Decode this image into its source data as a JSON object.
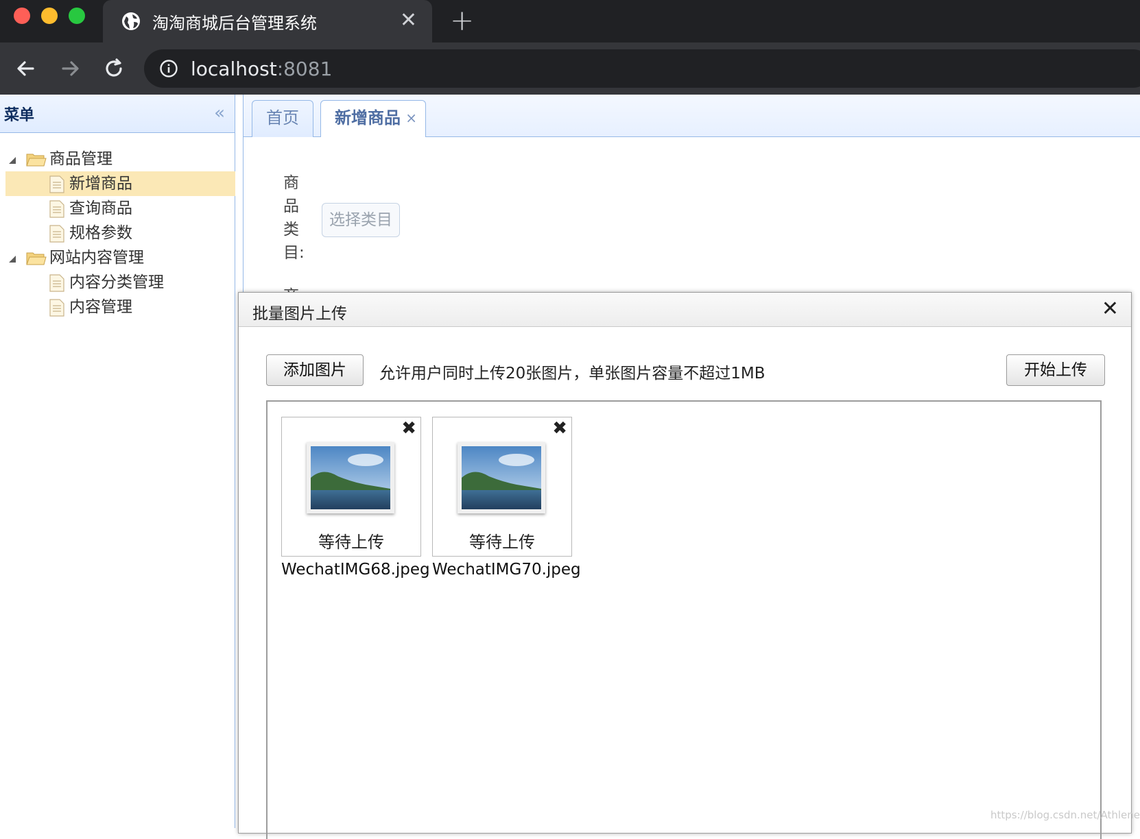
{
  "browser": {
    "tab_title": "淘淘商城后台管理系统",
    "tab_close": "✕",
    "new_tab": "+",
    "url_host": "localhost",
    "url_port": ":8081"
  },
  "menu": {
    "title": "菜单",
    "collapse": "«",
    "items": [
      {
        "label": "商品管理",
        "type": "folder"
      },
      {
        "label": "新增商品",
        "type": "file",
        "selected": true
      },
      {
        "label": "查询商品",
        "type": "file"
      },
      {
        "label": "规格参数",
        "type": "file"
      },
      {
        "label": "网站内容管理",
        "type": "folder"
      },
      {
        "label": "内容分类管理",
        "type": "file"
      },
      {
        "label": "内容管理",
        "type": "file"
      }
    ]
  },
  "tabs": {
    "home": "首页",
    "active": "新增商品",
    "active_close": "×"
  },
  "form": {
    "category_label": "商品类目:",
    "category_chars": [
      "商",
      "品",
      "类",
      "目:"
    ],
    "choose_button": "选择类目",
    "next_label_partial": "商"
  },
  "dialog": {
    "title": "批量图片上传",
    "close": "✕",
    "add_button": "添加图片",
    "hint": "允许用户同时上传20张图片，单张图片容量不超过1MB",
    "start_button": "开始上传",
    "files": [
      {
        "name": "WechatIMG68.jpeg",
        "status": "等待上传",
        "remove": "✖"
      },
      {
        "name": "WechatIMG70.jpeg",
        "status": "等待上传",
        "remove": "✖"
      }
    ]
  },
  "watermark": "https://blog.csdn.net/AthleneA",
  "colors": {
    "chrome_dark": "#202124",
    "chrome_tab": "#35363a",
    "easyui_border": "#95b8e7",
    "selected_node": "#fbe8b6"
  }
}
